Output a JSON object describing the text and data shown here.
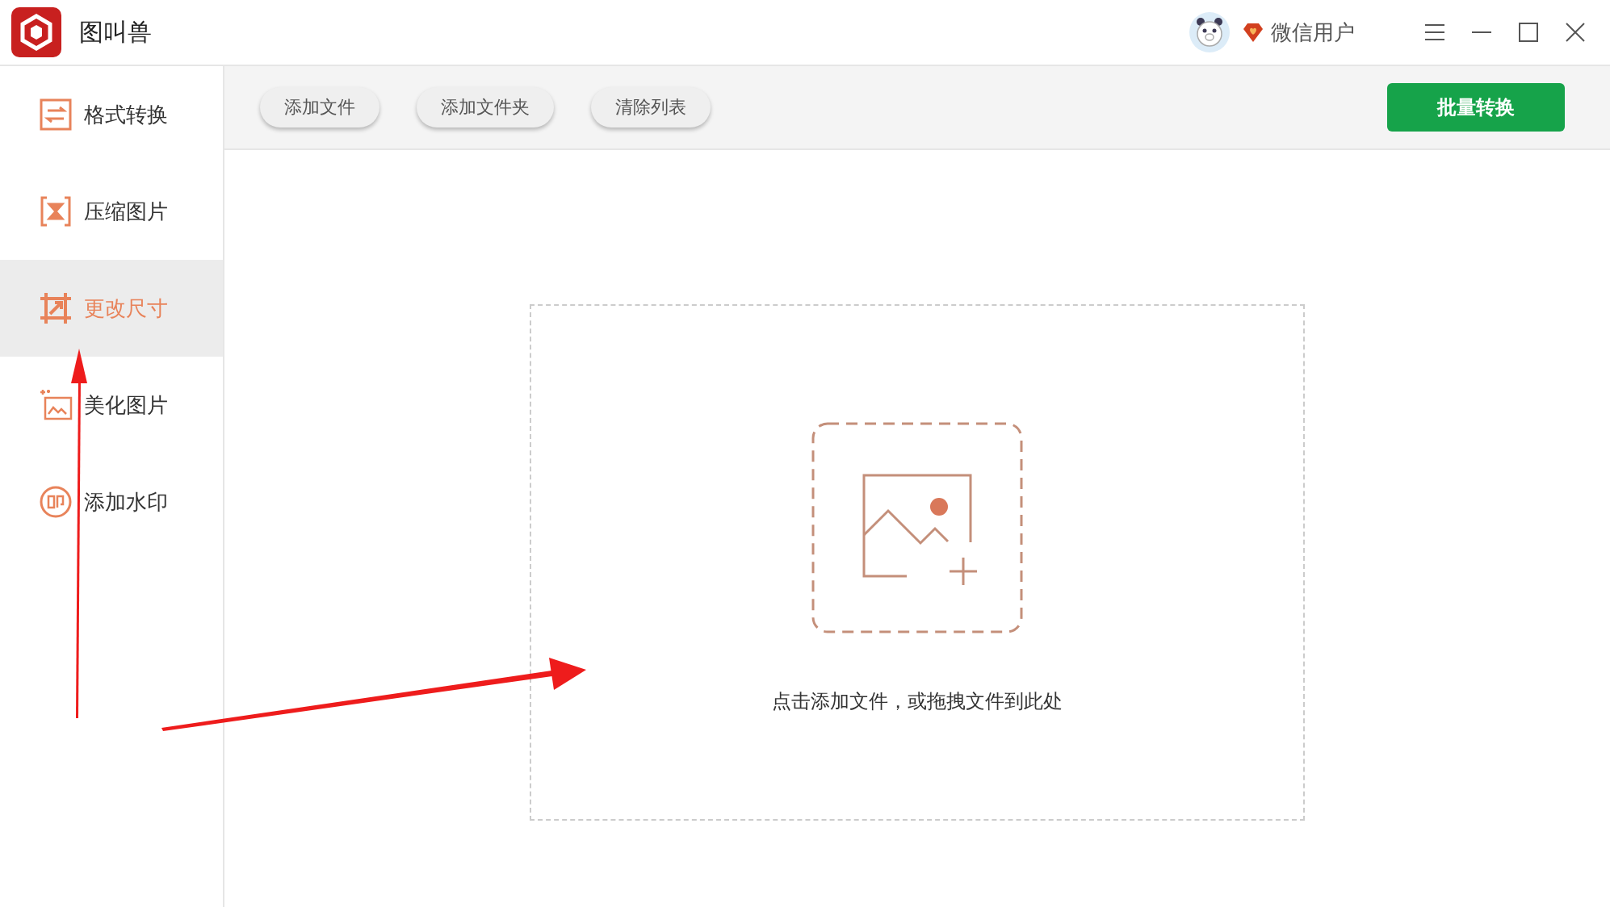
{
  "window": {
    "title": "图叫兽",
    "user": "微信用户"
  },
  "sidebar": {
    "items": [
      {
        "label": "格式转换",
        "kind": "convert",
        "selected": false
      },
      {
        "label": "压缩图片",
        "kind": "compress",
        "selected": false
      },
      {
        "label": "更改尺寸",
        "kind": "resize",
        "selected": true
      },
      {
        "label": "美化图片",
        "kind": "beautify",
        "selected": false
      },
      {
        "label": "添加水印",
        "kind": "watermark",
        "selected": false
      }
    ]
  },
  "toolbar": {
    "buttons": [
      "添加文件",
      "添加文件夹",
      "清除列表"
    ],
    "primary": "批量转换"
  },
  "dropzone": {
    "hint": "点击添加文件，或拖拽文件到此处"
  }
}
